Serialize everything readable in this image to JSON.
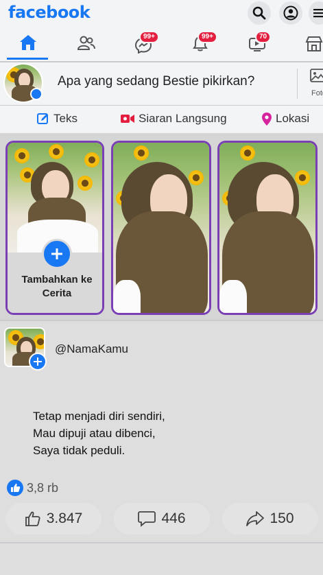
{
  "header": {
    "logo_text": "facebook"
  },
  "nav": {
    "badges": {
      "messenger": "99+",
      "notifications": "99+",
      "watch": "70"
    }
  },
  "composer": {
    "prompt": "Apa yang sedang Bestie pikirkan?",
    "photo_label": "Foto"
  },
  "actions": {
    "text": "Teks",
    "live": "Siaran Langsung",
    "location": "Lokasi"
  },
  "stories": {
    "add_label": "Tambahkan ke Cerita"
  },
  "post": {
    "username": "@NamaKamu",
    "lines": [
      "Tetap menjadi diri sendiri,",
      "Mau dipuji atau dibenci,",
      "Saya tidak peduli."
    ],
    "likes_summary": "3,8 rb",
    "like_count": "3.847",
    "comment_count": "446",
    "share_count": "150"
  },
  "colors": {
    "brand": "#1877f2",
    "badge": "#e41e3f",
    "story_border": "#7b3fb5"
  }
}
